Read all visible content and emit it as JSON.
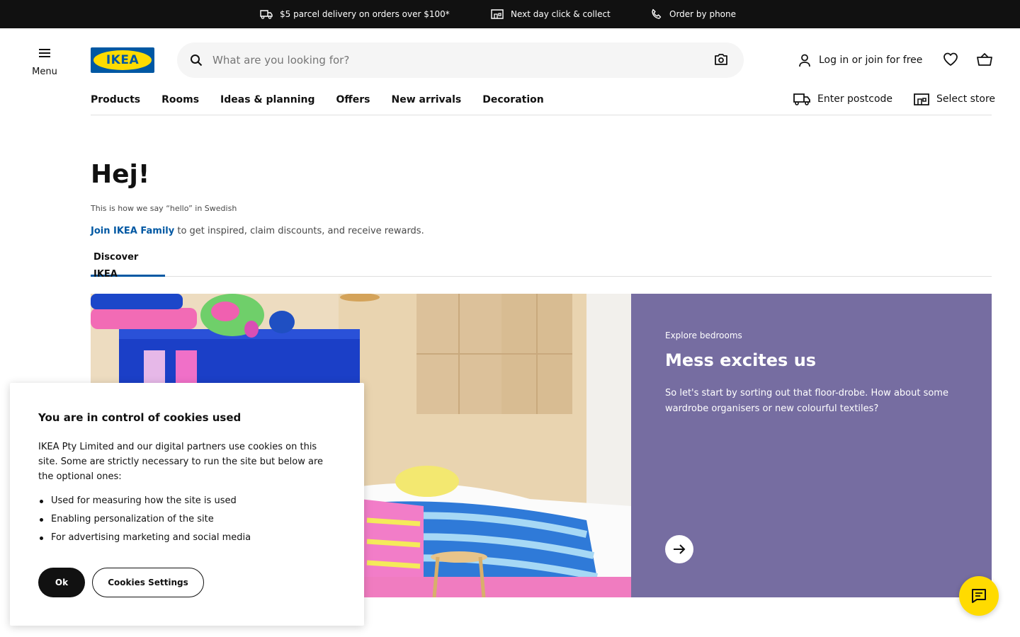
{
  "topbar": {
    "items": [
      {
        "label": "$5 parcel delivery on orders over $100*",
        "icon": "truck-icon"
      },
      {
        "label": "Next day click & collect",
        "icon": "store-icon"
      },
      {
        "label": "Order by phone",
        "icon": "phone-icon"
      }
    ]
  },
  "header": {
    "menu_label": "Menu",
    "logo_text": "IKEA",
    "search_placeholder": "What are you looking for?",
    "login_label": "Log in or join for free"
  },
  "nav": {
    "items": [
      "Products",
      "Rooms",
      "Ideas & planning",
      "Offers",
      "New arrivals",
      "Decoration"
    ],
    "postcode_label": "Enter postcode",
    "store_label": "Select store"
  },
  "hero": {
    "title": "Hej!",
    "subtitle": "This is how we say “hello” in Swedish",
    "family_link": "Join IKEA Family",
    "family_text": " to get inspired, claim discounts, and receive rewards.",
    "tab_label": "Discover IKEA"
  },
  "banner": {
    "eyebrow": "Explore bedrooms",
    "title": "Mess excites us",
    "text": "So let's start by sorting out that floor-drobe. How about some wardrobe organisers or new colourful textiles?",
    "panel_color": "#766da1"
  },
  "cookie": {
    "title": "You are in control of cookies used",
    "text": "IKEA Pty Limited and our digital partners use cookies on this site. Some are strictly necessary to run the site but below are the optional ones:",
    "items": [
      "Used for measuring how the site is used",
      "Enabling personalization of the site",
      "For advertising marketing and social media"
    ],
    "ok_label": "Ok",
    "settings_label": "Cookies Settings"
  },
  "colors": {
    "brand_blue": "#0058a3",
    "brand_yellow": "#ffdb00",
    "dark": "#111111"
  }
}
